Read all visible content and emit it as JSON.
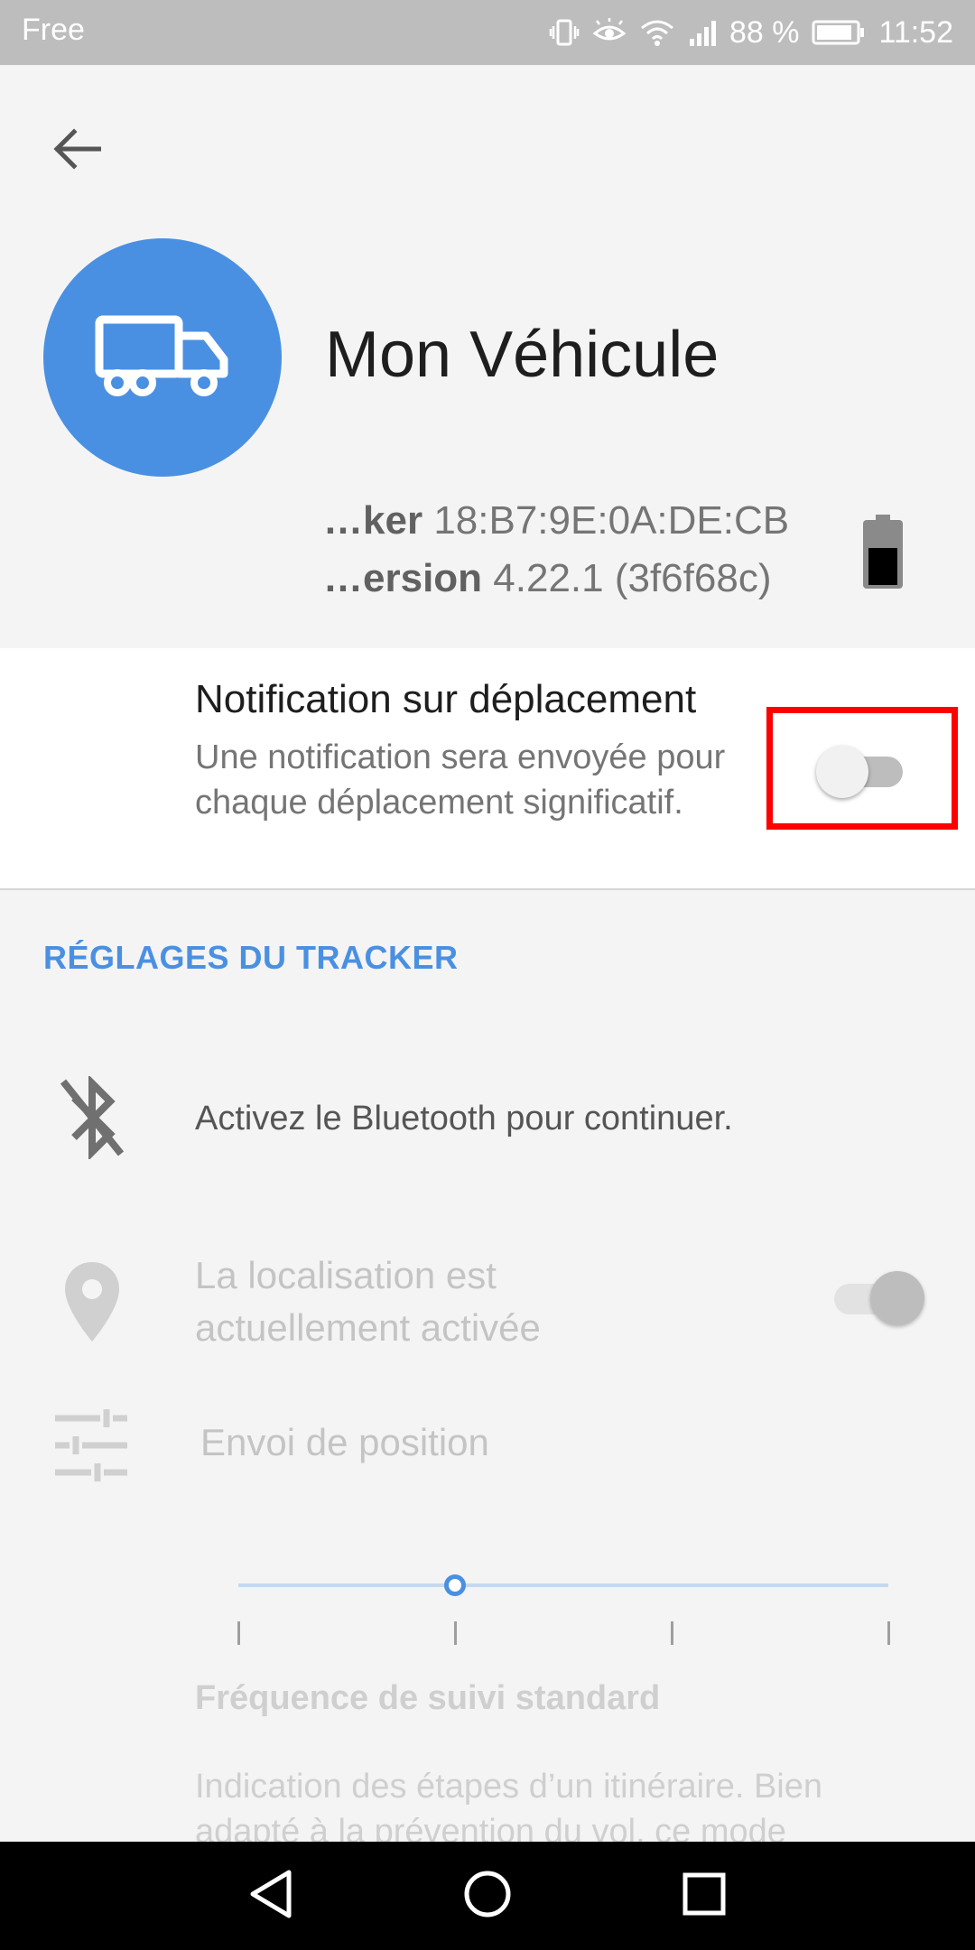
{
  "status_bar": {
    "carrier": "Free",
    "battery_percent": "88 %",
    "time": "11:52",
    "icons": [
      "vibrate-icon",
      "eye-icon",
      "wifi-icon",
      "signal-icon",
      "battery-icon"
    ]
  },
  "header": {
    "back_icon": "arrow-back-icon",
    "avatar_icon": "truck-icon",
    "device_name": "Mon Véhicule",
    "tracker_label": "…ker",
    "tracker_value": "18:B7:9E:0A:DE:CB",
    "version_label": "…ersion",
    "version_value": "4.22.1 (3f6f68c)",
    "battery_level": 0.6
  },
  "notification": {
    "title": "Notification sur déplacement",
    "description": "Une notification sera envoyée pour chaque déplacement significatif.",
    "enabled": false
  },
  "tracker_settings": {
    "section_title": "RÉGLAGES DU TRACKER",
    "bluetooth_text": "Activez le Bluetooth pour continuer.",
    "location_line1": "La localisation est",
    "location_line2": "actuellement activée",
    "location_enabled": true,
    "position_label": "Envoi de position",
    "frequency_steps": 4,
    "frequency_selected_index": 1,
    "frequency_title": "Fréquence de suivi standard",
    "frequency_desc": "Indication des étapes d’un itinéraire. Bien adapté à la prévention du vol, ce mode"
  },
  "colors": {
    "accent": "#4a90e2",
    "highlight": "#ff0000",
    "status_bar": "#bdbdbd"
  },
  "nav_bar": {
    "icons": [
      "nav-back-icon",
      "nav-home-icon",
      "nav-recents-icon"
    ]
  }
}
